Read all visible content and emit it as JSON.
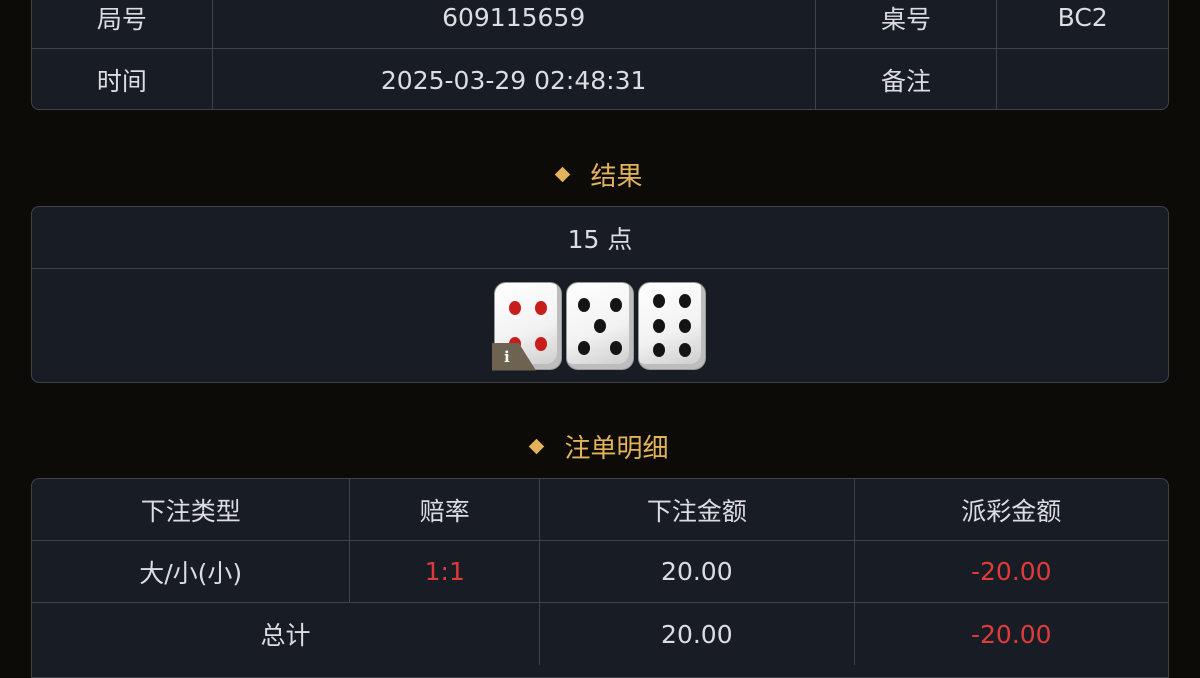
{
  "info": {
    "round_label": "局号",
    "round_value": "609115659",
    "table_label": "桌号",
    "table_value": "BC2",
    "time_label": "时间",
    "time_value": "2025-03-29 02:48:31",
    "note_label": "备注",
    "note_value": ""
  },
  "result": {
    "title": "结果",
    "points_text": "15 点",
    "dice": [
      4,
      5,
      6
    ],
    "dice_icon": "dice-icon",
    "info_icon_glyph": "i",
    "info_icon": "info-icon"
  },
  "bets": {
    "title": "注单明细",
    "headers": [
      "下注类型",
      "赔率",
      "下注金额",
      "派彩金额"
    ],
    "rows": [
      {
        "type": "大/小(小)",
        "odds": "1:1",
        "amount": "20.00",
        "payout": "-20.00"
      }
    ],
    "total": {
      "label": "总计",
      "amount": "20.00",
      "payout": "-20.00"
    }
  },
  "colors": {
    "background": "#0d0b08",
    "panel": "#171c25",
    "accent_gold": "#e2b35a",
    "negative_red": "#e03b3b"
  }
}
